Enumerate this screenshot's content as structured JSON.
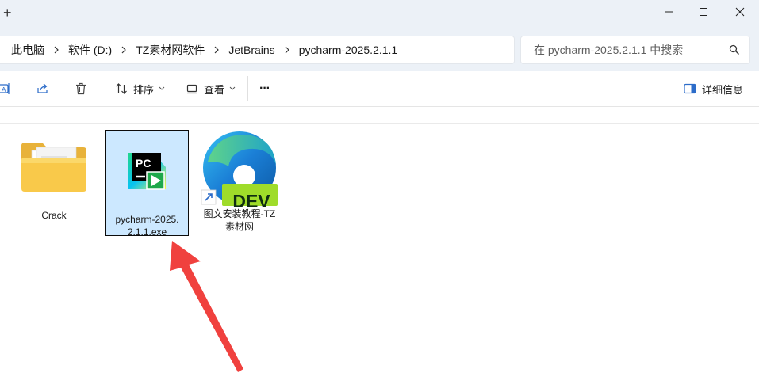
{
  "titlebar": {
    "new_tab": "+",
    "minimize_icon": "minimize-icon",
    "maximize_icon": "maximize-icon",
    "close_icon": "close-icon"
  },
  "address": {
    "crumbs": [
      "此电脑",
      "软件 (D:)",
      "TZ素材网软件",
      "JetBrains",
      "pycharm-2025.2.1.1"
    ]
  },
  "search": {
    "placeholder": "在 pycharm-2025.2.1.1 中搜索"
  },
  "toolbar": {
    "sort_label": "排序",
    "view_label": "查看",
    "more_label": "···",
    "details_label": "详细信息"
  },
  "files": [
    {
      "name": "Crack",
      "type": "folder",
      "selected": false
    },
    {
      "name": "pycharm-2025.2.1.1.exe",
      "name_line1": "pycharm-2025.",
      "name_line2": "2.1.1.exe",
      "type": "exe",
      "selected": true
    },
    {
      "name": "图文安装教程-TZ素材网",
      "name_line1": "图文安装教程-TZ",
      "name_line2": "素材网",
      "type": "shortcut",
      "icon_badge": "DEV",
      "selected": false
    }
  ],
  "icons": {
    "pycharm_logo_text": "PC"
  },
  "colors": {
    "selection": "#cce8ff",
    "arrow": "#f0413e",
    "titlebar": "#ecf1f7"
  }
}
